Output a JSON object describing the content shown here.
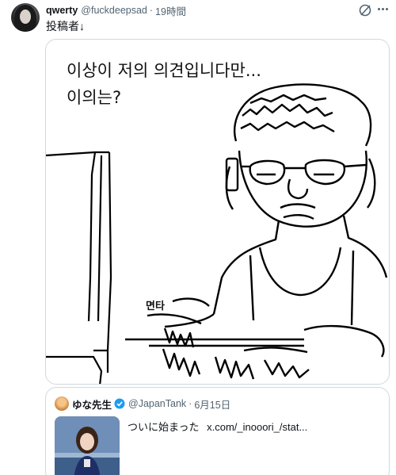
{
  "tweet": {
    "display_name": "qwerty",
    "handle": "@fuckdeepsad",
    "separator": "·",
    "time": "19時間",
    "text": "投稿者↓"
  },
  "media": {
    "caption_line1": "이상이 저의 의견입니다만...",
    "caption_line2": "이의는?",
    "nameplate": "면타"
  },
  "quote": {
    "display_name": "ゆな先生",
    "handle": "@JapanTank",
    "separator": "·",
    "time": "6月15日",
    "text": "ついに始まった",
    "link": "x.com/_inooori_/stat..."
  },
  "icons": {
    "grok": "grok-icon",
    "more": "more-icon",
    "verified": "verified-badge-icon"
  },
  "colors": {
    "verified_blue": "#1d9bf0",
    "secondary_text": "#536471",
    "border": "#cfd9de"
  }
}
